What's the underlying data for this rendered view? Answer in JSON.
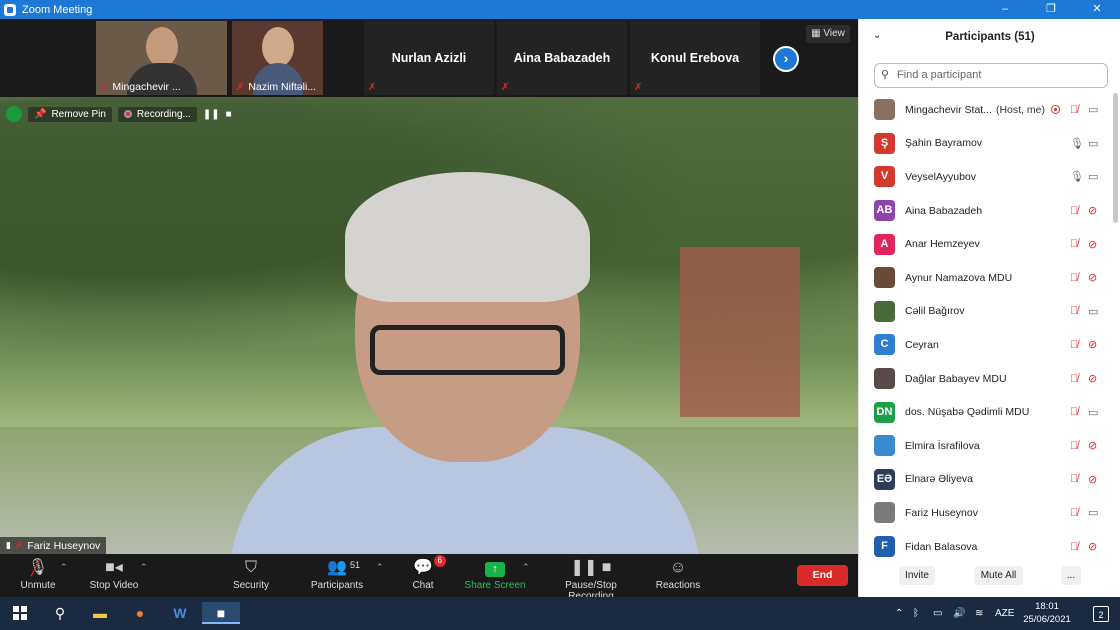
{
  "window": {
    "title": "Zoom Meeting",
    "controls": [
      "–",
      "❐",
      "✕"
    ]
  },
  "thumbnails": [
    {
      "name": "Mingachevir ...",
      "has_video": true
    },
    {
      "name": "Nazim Niftəli...",
      "has_video": true
    },
    {
      "name": "Nurlan Azizli",
      "has_video": false
    },
    {
      "name": "Aina Babazadeh",
      "has_video": false
    },
    {
      "name": "Konul Erebova",
      "has_video": false
    }
  ],
  "view_button": "View",
  "recording_bar": {
    "remove_pin": "Remove Pin",
    "recording": "Recording..."
  },
  "active_speaker": "Fariz Huseynov",
  "toolbar": {
    "unmute": "Unmute",
    "stop_video": "Stop Video",
    "security": "Security",
    "participants": "Participants",
    "participants_count": "51",
    "chat": "Chat",
    "chat_badge": "6",
    "share_screen": "Share Screen",
    "pause_stop_recording": "Pause/Stop Recording",
    "reactions": "Reactions",
    "end": "End"
  },
  "panel": {
    "title": "Participants (51)",
    "search_placeholder": "Find a participant",
    "participants": [
      {
        "name": "Mingachevir Stat...",
        "tag": "(Host, me)",
        "initials": "",
        "color": "#8a7060",
        "mic": "off",
        "cam": "on",
        "recording": true
      },
      {
        "name": "Şahin Bayramov",
        "initials": "Ş",
        "color": "#d33a2c",
        "mic": "on",
        "cam": "on"
      },
      {
        "name": "VeyselAyyubov",
        "initials": "V",
        "color": "#d33a2c",
        "mic": "on",
        "cam": "on"
      },
      {
        "name": "Aina Babazadeh",
        "initials": "AB",
        "color": "#8e44ad",
        "mic": "off",
        "cam": "off"
      },
      {
        "name": "Anar Hemzeyev",
        "initials": "A",
        "color": "#e0245e",
        "mic": "off",
        "cam": "off"
      },
      {
        "name": "Aynur Namazova MDU",
        "initials": "",
        "color": "#6b4a3a",
        "mic": "off",
        "cam": "off"
      },
      {
        "name": "Cəlil Bağırov",
        "initials": "",
        "color": "#4a6a3a",
        "mic": "off",
        "cam": "on"
      },
      {
        "name": "Ceyran",
        "initials": "C",
        "color": "#2d7fd3",
        "mic": "off",
        "cam": "off"
      },
      {
        "name": "Dağlar Babayev MDU",
        "initials": "",
        "color": "#5a4a4a",
        "mic": "off",
        "cam": "off"
      },
      {
        "name": "dos. Nüşabə Qədimli MDU",
        "initials": "DN",
        "color": "#1f9e4a",
        "mic": "off",
        "cam": "on"
      },
      {
        "name": "Elmira İsrafilova",
        "initials": "",
        "color": "#3a8ad0",
        "mic": "off",
        "cam": "off"
      },
      {
        "name": "Elnarə Əliyeva",
        "initials": "EƏ",
        "color": "#2a3d5a",
        "mic": "off",
        "cam": "off"
      },
      {
        "name": "Fariz Huseynov",
        "initials": "",
        "color": "#7a7a7a",
        "mic": "off",
        "cam": "on"
      },
      {
        "name": "Fidan Balasova",
        "initials": "F",
        "color": "#1f5fb0",
        "mic": "off",
        "cam": "off"
      }
    ],
    "invite": "Invite",
    "mute_all": "Mute All",
    "more": "..."
  },
  "taskbar": {
    "language": "AZE",
    "time": "18:01",
    "date": "25/06/2021",
    "notifications": "2"
  }
}
